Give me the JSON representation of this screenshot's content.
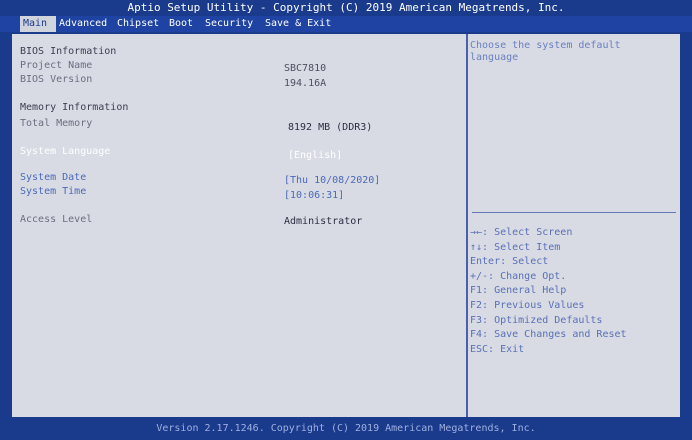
{
  "title": "Aptio Setup Utility - Copyright (C) 2019 American Megatrends, Inc.",
  "tabs": [
    {
      "label": "Main",
      "active": true
    },
    {
      "label": "Advanced",
      "active": false
    },
    {
      "label": "Chipset",
      "active": false
    },
    {
      "label": "Boot",
      "active": false
    },
    {
      "label": "Security",
      "active": false
    },
    {
      "label": "Save & Exit",
      "active": false
    }
  ],
  "main": {
    "bios_info_header": "BIOS Information",
    "project_name_label": "Project Name",
    "project_name_value": "SBC7810",
    "bios_version_label": "BIOS Version",
    "bios_version_value": "194.16A",
    "memory_info_header": "Memory Information",
    "total_memory_label": "Total Memory",
    "total_memory_value": "8192 MB (DDR3)",
    "system_language_label": "System Language",
    "system_language_value": "[English]",
    "system_date_label": "System Date",
    "system_date_value": "[Thu 10/08/2020]",
    "system_time_label": "System Time",
    "system_time_value": "[10:06:31]",
    "access_level_label": "Access Level",
    "access_level_value": "Administrator"
  },
  "help": {
    "description": "Choose the system default language",
    "keys": [
      "→←: Select Screen",
      "↑↓: Select Item",
      "Enter: Select",
      "+/-: Change Opt.",
      "F1: General Help",
      "F2: Previous Values",
      "F3: Optimized Defaults",
      "F4: Save Changes and Reset",
      "ESC: Exit"
    ]
  },
  "footer": "Version 2.17.1246. Copyright (C) 2019 American Megatrends, Inc.",
  "colors": {
    "background": "#1a3a8c",
    "panel": "#d8dbe3",
    "accent": "#4a6ab8",
    "highlight": "#ffffff"
  }
}
